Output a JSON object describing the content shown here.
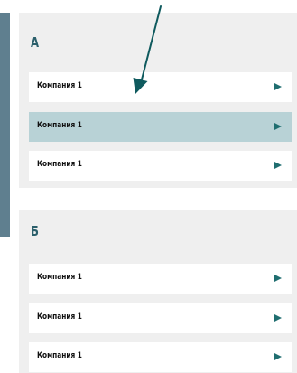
{
  "groups": [
    {
      "letter": "А",
      "items": [
        {
          "label": "Компания 1",
          "active": false,
          "icon": "play-arrow-icon"
        },
        {
          "label": "Компания 1",
          "active": true,
          "icon": "play-arrow-icon"
        },
        {
          "label": "Компания 1",
          "active": false,
          "icon": "play-arrow-icon"
        }
      ]
    },
    {
      "letter": "Б",
      "items": [
        {
          "label": "Компания 1",
          "active": false,
          "icon": "play-arrow-icon"
        },
        {
          "label": "Компания 1",
          "active": false,
          "icon": "play-arrow-icon"
        },
        {
          "label": "Компания 1",
          "active": false,
          "icon": "play-arrow-icon"
        }
      ]
    }
  ],
  "colors": {
    "accent": "#1f6e70",
    "active_row": "#b8d2d6",
    "panel_bg": "#efefef",
    "left_border": "#5f7f8f"
  },
  "annotation": {
    "icon": "pointer-arrow-icon"
  }
}
